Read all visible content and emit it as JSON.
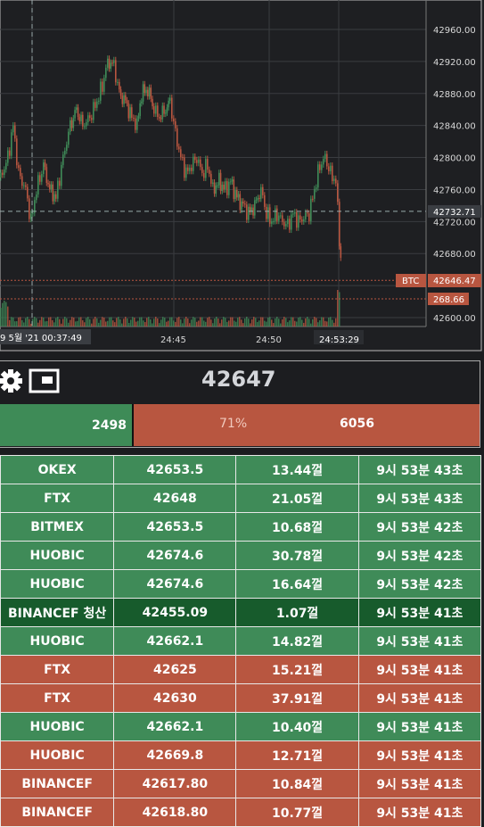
{
  "chart": {
    "y_labels": [
      "42960.00",
      "42920.00",
      "42880.00",
      "42840.00",
      "42800.00",
      "42760.00",
      "42720.00",
      "42680.00",
      "42600.00"
    ],
    "crosshair_price": "42732.71",
    "last_price_tag": "42646.47",
    "btc_tag": "BTC",
    "secondary_tag": "268.66",
    "x_labels": [
      "24:45",
      "24:50"
    ],
    "crosshair_time": "24:53:29",
    "date_label": "9 5월 '21   00:37:49",
    "up_color": "#3f8b58",
    "down_color": "#b85640"
  },
  "panel": {
    "settings_icon": "gear-icon",
    "window_icon": "window-icon",
    "price": "42647",
    "buy_value": "2498",
    "percent": "71%",
    "sell_value": "6056"
  },
  "trades": [
    {
      "exchange": "OKEX",
      "price": "42653.5",
      "qty": "13.44껄",
      "time": "9시 53분 43초",
      "side": "buy"
    },
    {
      "exchange": "FTX",
      "price": "42648",
      "qty": "21.05껄",
      "time": "9시 53분 43초",
      "side": "buy"
    },
    {
      "exchange": "BITMEX",
      "price": "42653.5",
      "qty": "10.68껄",
      "time": "9시 53분 42초",
      "side": "buy"
    },
    {
      "exchange": "HUOBIC",
      "price": "42674.6",
      "qty": "30.78껄",
      "time": "9시 53분 42초",
      "side": "buy"
    },
    {
      "exchange": "HUOBIC",
      "price": "42674.6",
      "qty": "16.64껄",
      "time": "9시 53분 42초",
      "side": "buy"
    },
    {
      "exchange": "BINANCEF 청산",
      "price": "42455.09",
      "qty": "1.07껄",
      "time": "9시 53분 41초",
      "side": "liq"
    },
    {
      "exchange": "HUOBIC",
      "price": "42662.1",
      "qty": "14.82껄",
      "time": "9시 53분 41초",
      "side": "buy"
    },
    {
      "exchange": "FTX",
      "price": "42625",
      "qty": "15.21껄",
      "time": "9시 53분 41초",
      "side": "sell"
    },
    {
      "exchange": "FTX",
      "price": "42630",
      "qty": "37.91껄",
      "time": "9시 53분 41초",
      "side": "sell"
    },
    {
      "exchange": "HUOBIC",
      "price": "42662.1",
      "qty": "10.40껄",
      "time": "9시 53분 41초",
      "side": "buy"
    },
    {
      "exchange": "HUOBIC",
      "price": "42669.8",
      "qty": "12.71껄",
      "time": "9시 53분 41초",
      "side": "sell"
    },
    {
      "exchange": "BINANCEF",
      "price": "42617.80",
      "qty": "10.84껄",
      "time": "9시 53분 41초",
      "side": "sell"
    },
    {
      "exchange": "BINANCEF",
      "price": "42618.80",
      "qty": "10.77껄",
      "time": "9시 53분 41초",
      "side": "sell"
    }
  ]
}
